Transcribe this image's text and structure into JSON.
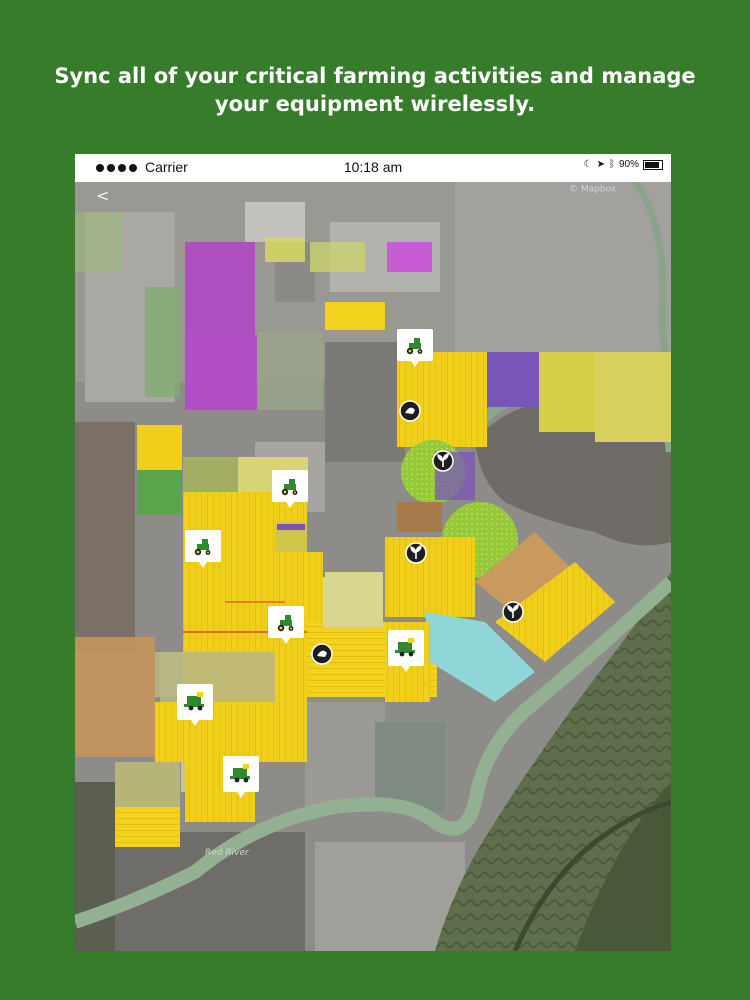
{
  "headline": "Sync all of your critical farming activities and manage your equipment wirelessly.",
  "status_bar": {
    "carrier": "Carrier",
    "time": "10:18 am",
    "battery": "90%"
  },
  "map": {
    "attribution": "© Mapbox",
    "river_label": "Red River",
    "markers": [
      {
        "type": "tractor-icon"
      },
      {
        "type": "tractor-icon"
      },
      {
        "type": "tractor-icon"
      },
      {
        "type": "tractor-icon"
      },
      {
        "type": "combine-icon"
      },
      {
        "type": "combine-icon"
      },
      {
        "type": "combine-icon"
      },
      {
        "type": "sprayer-icon"
      },
      {
        "type": "sprayer-icon"
      },
      {
        "type": "seed-icon"
      },
      {
        "type": "seed-icon"
      },
      {
        "type": "seed-icon"
      }
    ]
  },
  "colors": {
    "brand_green": "#367c2b",
    "yield_yellow": "#f2d21c",
    "pivot_green": "#8fc43a",
    "water_cyan": "#8fd6d8",
    "field_magenta": "#b04fc0",
    "field_purple": "#7a55b8"
  }
}
